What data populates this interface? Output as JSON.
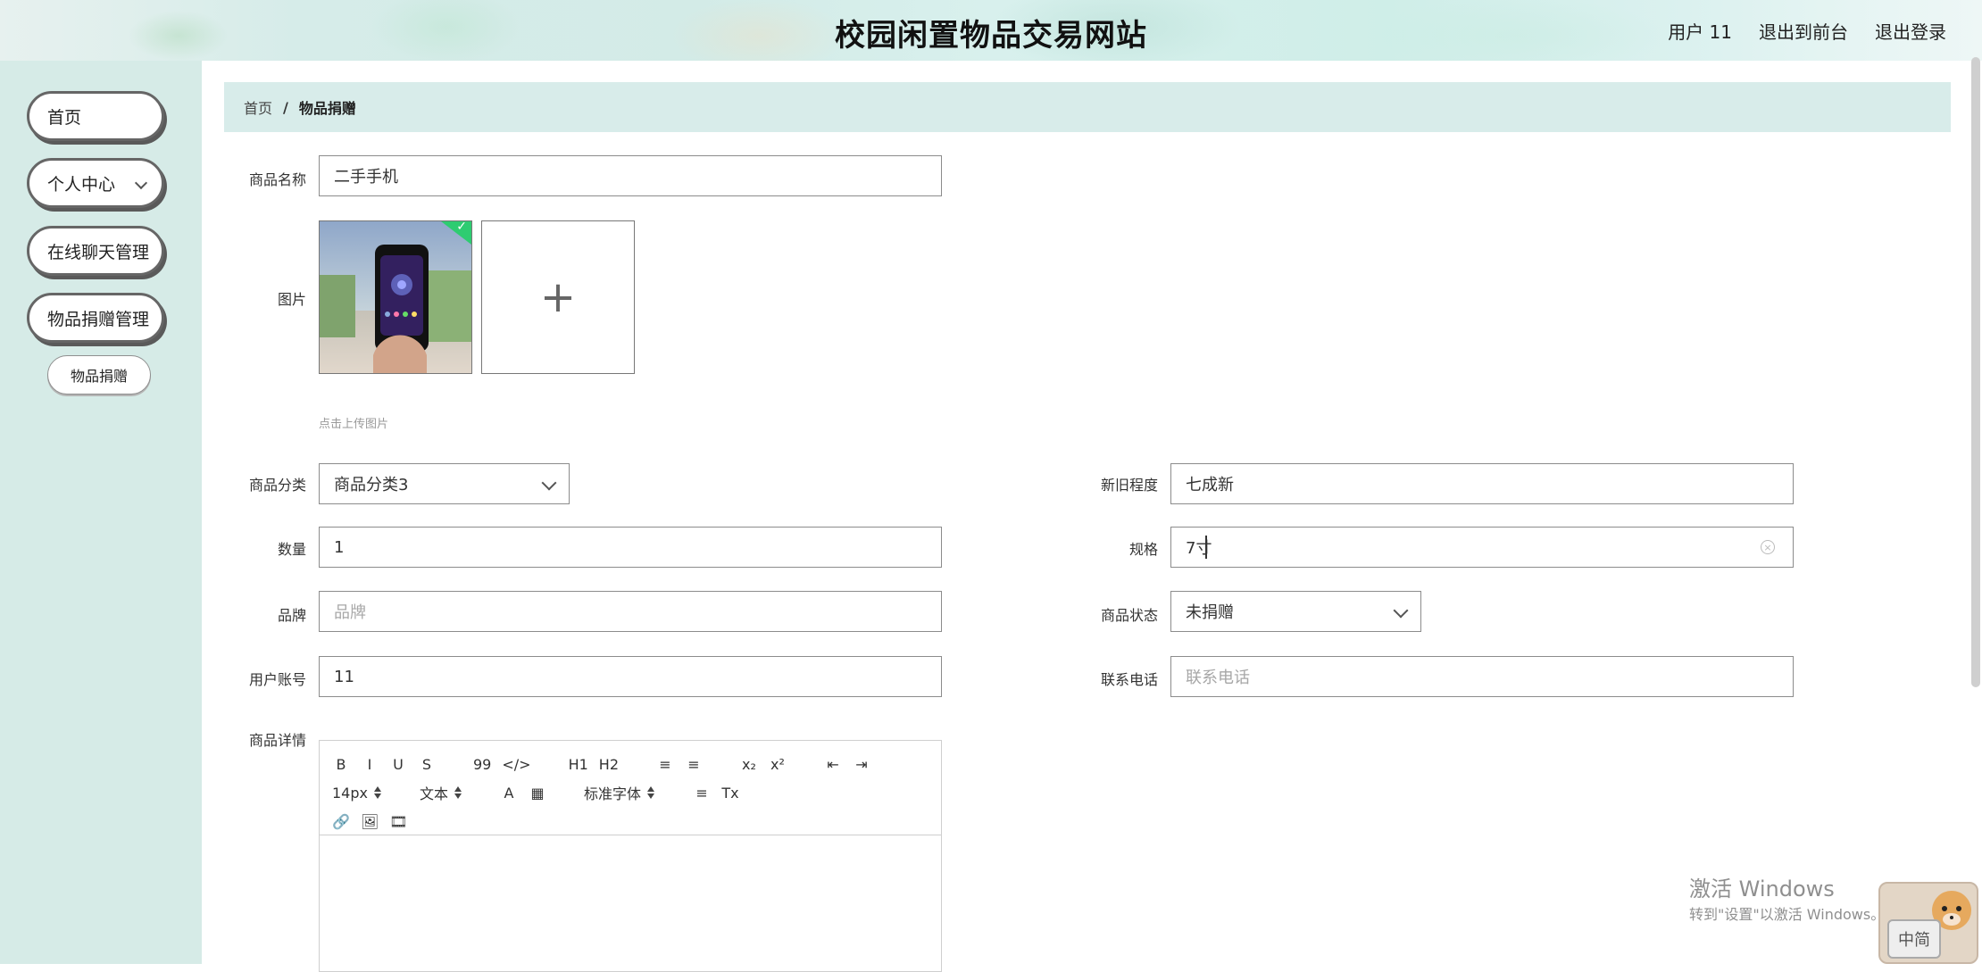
{
  "header": {
    "title": "校园闲置物品交易网站",
    "user_label": "用户 11",
    "to_front": "退出到前台",
    "logout": "退出登录"
  },
  "sidebar": {
    "items": [
      {
        "label": "首页"
      },
      {
        "label": "个人中心"
      },
      {
        "label": "在线聊天管理"
      },
      {
        "label": "物品捐赠管理"
      }
    ],
    "submenu": {
      "label": "物品捐赠"
    }
  },
  "breadcrumb": {
    "home": "首页",
    "separator": "/",
    "current": "物品捐赠"
  },
  "form": {
    "name_label": "商品名称",
    "name_value": "二手手机",
    "image_label": "图片",
    "upload_tip": "点击上传图片",
    "category_label": "商品分类",
    "category_value": "商品分类3",
    "condition_label": "新旧程度",
    "condition_value": "七成新",
    "quantity_label": "数量",
    "quantity_value": "1",
    "spec_label": "规格",
    "spec_value": "7寸",
    "brand_label": "品牌",
    "brand_placeholder": "品牌",
    "status_label": "商品状态",
    "status_value": "未捐赠",
    "account_label": "用户账号",
    "account_value": "11",
    "phone_label": "联系电话",
    "phone_placeholder": "联系电话",
    "details_label": "商品详情"
  },
  "editor": {
    "toolbar_row1": [
      "B",
      "I",
      "U",
      "S",
      "99",
      "</>",
      "H1",
      "H2",
      "≡",
      "≡",
      "x₂",
      "x²",
      "⇤",
      "⇥"
    ],
    "font_size": "14px",
    "text_style": "文本",
    "font_family": "标准字体"
  },
  "watermark": {
    "line1": "激活 Windows",
    "line2": "转到\"设置\"以激活 Windows。"
  },
  "mascot": {
    "badge_text": "中简"
  }
}
